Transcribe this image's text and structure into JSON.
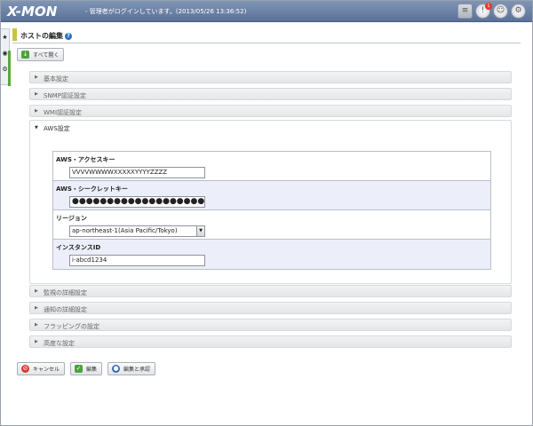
{
  "header": {
    "logo": "X-MON",
    "login_info": "- 管理者がログインしています。(2013/05/26 13:36:52)",
    "icons": [
      "database-icon",
      "alert-icon",
      "user-icon",
      "settings-icon"
    ],
    "badge_count": "1"
  },
  "sidebar": {
    "tabs": [
      "★",
      "◉",
      "⚙"
    ]
  },
  "page": {
    "title": "ホストの編集",
    "help": "?"
  },
  "toolbar": {
    "expand_all": "すべて開く"
  },
  "sections_top": [
    {
      "label": "基本設定"
    },
    {
      "label": "SNMP認証設定"
    },
    {
      "label": "WMI認証設定"
    }
  ],
  "aws": {
    "label": "AWS設定",
    "access_key_label": "AWS・アクセスキー",
    "access_key_value": "VVVVWWWWXXXXXYYYYZZZZ",
    "secret_key_label": "AWS・シークレットキー",
    "secret_key_value": "●●●●●●●●●●●●●●●●●●●●",
    "region_label": "リージョン",
    "region_value": "ap-northeast-1(Asia Pacific/Tokyo)",
    "instance_label": "インスタンスID",
    "instance_value": "i-abcd1234"
  },
  "sections_bottom": [
    {
      "label": "監視の詳細設定"
    },
    {
      "label": "通知の詳細設定"
    },
    {
      "label": "フラッピングの設定"
    },
    {
      "label": "高度な設定"
    }
  ],
  "footer": {
    "cancel": "キャンセル",
    "edit": "編集",
    "edit_apply": "編集と承認"
  },
  "colors": {
    "header_bg": "#6b83a8",
    "title_mark": "#c9c441",
    "alt_row": "#eceef9",
    "cancel_icon": "#d83a2c",
    "edit_icon": "#4da23b",
    "apply_icon": "#2f6db8"
  }
}
